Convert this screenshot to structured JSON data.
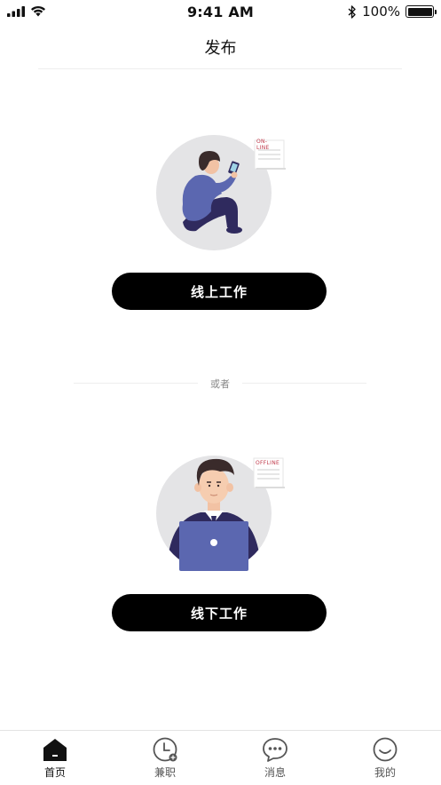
{
  "status_bar": {
    "time": "9:41 AM",
    "battery": "100%",
    "battery_level": 1.0
  },
  "nav": {
    "title": "发布"
  },
  "online": {
    "tag": "ON-LINE",
    "button_label": "线上工作"
  },
  "divider": {
    "text": "或者"
  },
  "offline": {
    "tag": "OFFLINE",
    "button_label": "线下工作"
  },
  "tab_bar": {
    "items": [
      {
        "label": "首页",
        "icon": "home-icon",
        "active": true
      },
      {
        "label": "兼职",
        "icon": "clock-icon",
        "active": false
      },
      {
        "label": "消息",
        "icon": "message-icon",
        "active": false
      },
      {
        "label": "我的",
        "icon": "smile-icon",
        "active": false
      }
    ]
  },
  "colors": {
    "accent": "#000000",
    "illustration_bg": "#e4e4e6",
    "figure_blue": "#5b67b0",
    "tag_red": "#c0394a"
  }
}
